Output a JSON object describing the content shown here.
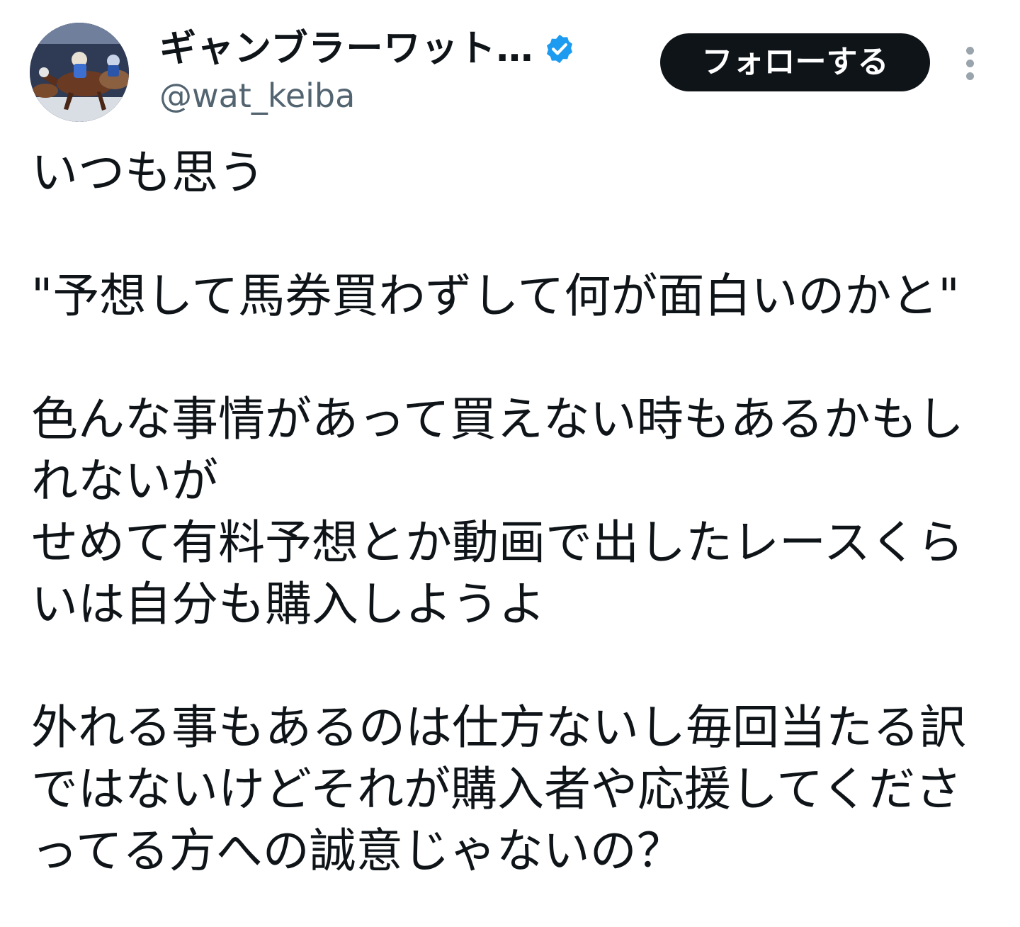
{
  "author": {
    "display_name": "ギャンブラーワット…",
    "handle": "@wat_keiba",
    "verified": true,
    "verified_color": "#1d9bf0"
  },
  "actions": {
    "follow_label": "フォローする",
    "more_icon": "more-vertical-icon"
  },
  "tweet": {
    "lines": [
      "いつも思う",
      "",
      "\"予想して馬券買わずして何が面白いのかと\"",
      "",
      "色んな事情があって買えない時もあるかもし",
      "れないが",
      "せめて有料予想とか動画で出したレースくら",
      "いは自分も購入しようよ",
      "",
      "外れる事もあるのは仕方ないし毎回当たる訳",
      "ではないけどそれが購入者や応援してくださ",
      "ってる方への誠意じゃないの？"
    ]
  },
  "colors": {
    "text": "#0f1419",
    "secondary_text": "#536471",
    "button_bg": "#0f1419",
    "button_text": "#ffffff"
  }
}
